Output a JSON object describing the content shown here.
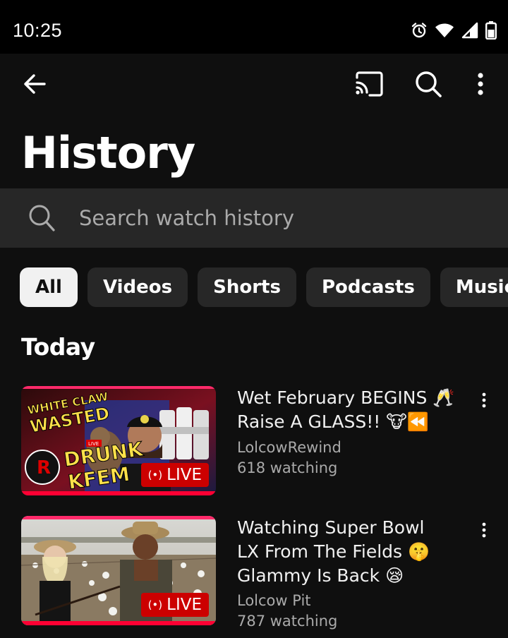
{
  "status_bar": {
    "time": "10:25",
    "icons": [
      "alarm-icon",
      "wifi-icon",
      "cellular-signal-icon",
      "battery-icon"
    ]
  },
  "top_bar": {
    "icons": [
      "back-arrow-icon",
      "cast-icon",
      "search-icon",
      "more-vertical-icon"
    ]
  },
  "page": {
    "title": "History"
  },
  "search": {
    "placeholder": "Search watch history",
    "value": ""
  },
  "filters": {
    "selected": "All",
    "chips": [
      "All",
      "Videos",
      "Shorts",
      "Podcasts",
      "Music"
    ]
  },
  "sections": [
    {
      "title": "Today",
      "videos": [
        {
          "title_line1": "Wet February BEGINS 🥂",
          "title_line2": "Raise A GLASS!! 🐮⏪",
          "channel": "LolcowRewind",
          "meta": "618 watching",
          "badge": "LIVE",
          "thumbnail_text": [
            "WHITE CLAW",
            "WASTED",
            "DRUNK",
            "KFEM",
            "LIVE"
          ]
        },
        {
          "title_line1": "Watching Super Bowl",
          "title_line2": "LX From The Fields 🤫",
          "title_line3": "Glammy Is Back 😪",
          "channel": "Lolcow Pit",
          "meta": "787 watching",
          "badge": "LIVE"
        }
      ]
    }
  ],
  "colors": {
    "background": "#0f0f0f",
    "surface": "#272727",
    "text_primary": "#f1f1f1",
    "text_secondary": "#aaaaaa",
    "live_red": "#cc0000",
    "progress_red": "#ff0033"
  }
}
